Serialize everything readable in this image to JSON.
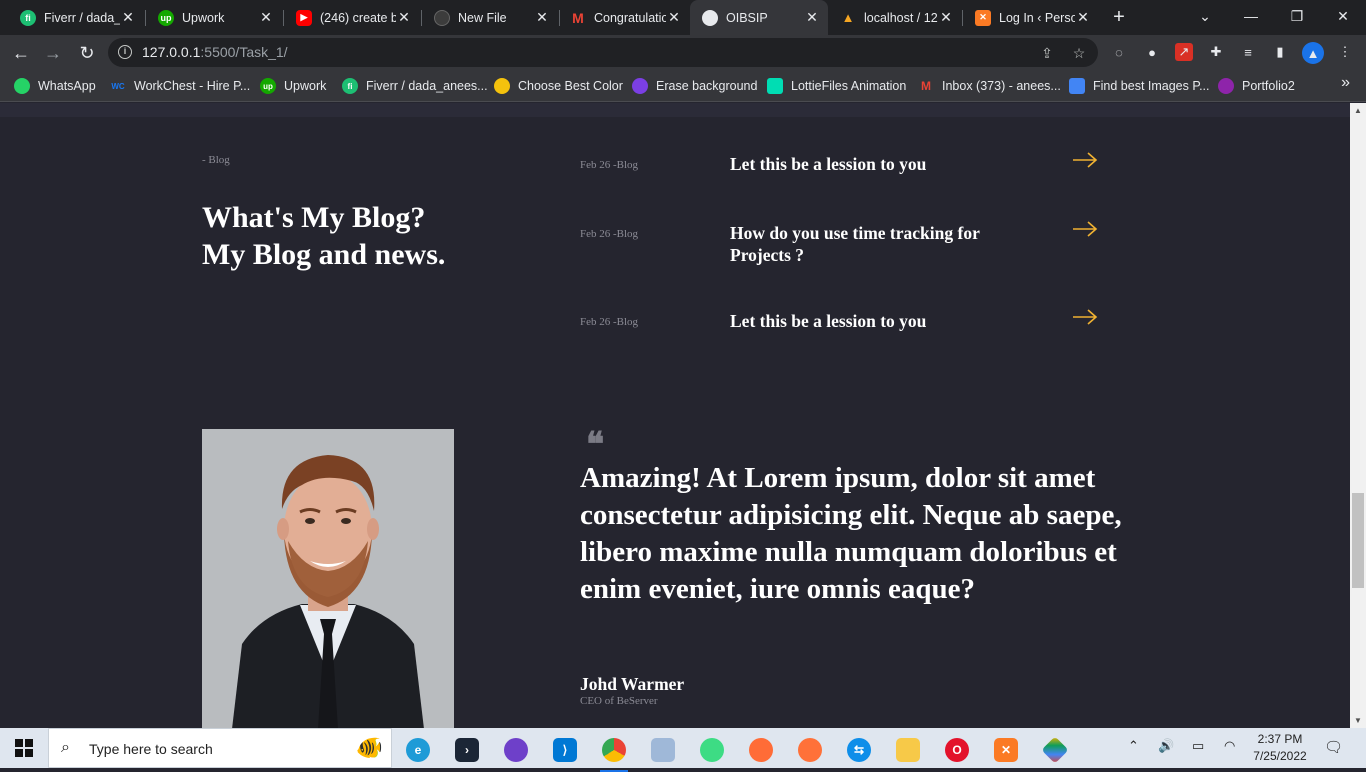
{
  "browser": {
    "tabs": [
      {
        "title": "Fiverr / dada_",
        "icon": "fiverr-icon",
        "color": "#1dbf73",
        "glyph": "fi"
      },
      {
        "title": "Upwork",
        "icon": "upwork-icon",
        "color": "#14a800",
        "glyph": "up"
      },
      {
        "title": "(246) create b",
        "icon": "youtube-icon",
        "color": "#ff0000",
        "glyph": "▶"
      },
      {
        "title": "New File",
        "icon": "github-icon",
        "color": "#444",
        "glyph": ""
      },
      {
        "title": "Congratulatio",
        "icon": "gmail-icon",
        "color": "#ffffff",
        "glyph": "M"
      },
      {
        "title": "OIBSIP",
        "icon": "globe-icon",
        "color": "#e8eaed",
        "glyph": ""
      },
      {
        "title": "localhost / 12",
        "icon": "phpmyadmin-icon",
        "color": "#f5a623",
        "glyph": ""
      },
      {
        "title": "Log In ‹ Perso",
        "icon": "xampp-icon",
        "color": "#fb7a24",
        "glyph": "✕"
      }
    ],
    "url_host": "127.0.0.1",
    "url_rest": ":5500/Task_1/",
    "bookmarks": [
      {
        "label": "WhatsApp",
        "icon": "whatsapp-icon",
        "color": "#25d366"
      },
      {
        "label": "WorkChest - Hire P...",
        "icon": "workchest-icon",
        "color": "#1877f2"
      },
      {
        "label": "Upwork",
        "icon": "upwork-icon",
        "color": "#14a800"
      },
      {
        "label": "Fiverr / dada_anees...",
        "icon": "fiverr-icon",
        "color": "#1dbf73"
      },
      {
        "label": "Choose Best Color",
        "icon": "color-icon",
        "color": "#f4c20d"
      },
      {
        "label": "Erase background",
        "icon": "erase-icon",
        "color": "#7b3fe4"
      },
      {
        "label": "LottieFiles Animation",
        "icon": "lottie-icon",
        "color": "#00ddb3"
      },
      {
        "label": "Inbox (373) - anees...",
        "icon": "gmail-icon",
        "color": "#ea4335"
      },
      {
        "label": "Find best Images P...",
        "icon": "images-icon",
        "color": "#4285f4"
      },
      {
        "label": "Portfolio2",
        "icon": "portfolio-icon",
        "color": "#8e24aa"
      }
    ]
  },
  "blog": {
    "tag": "- Blog",
    "title_line1": "What's My Blog?",
    "title_line2": "My Blog and news.",
    "posts": [
      {
        "date": "Feb 26 -Blog",
        "title": "Let this be a lession to you"
      },
      {
        "date": "Feb 26 -Blog",
        "title": "How do you use time tracking for Projects ?"
      },
      {
        "date": "Feb 26 -Blog",
        "title": "Let this be a lession to you"
      }
    ]
  },
  "testimonial": {
    "mark": "66",
    "quote": "Amazing! At Lorem ipsum, dolor sit amet consectetur adipisicing elit. Neque ab saepe, libero maxime nulla numquam doloribus et enim eveniet, iure omnis eaque?",
    "author": "Johd Warmer",
    "role": "CEO of BeServer"
  },
  "colors": {
    "page_bg": "#25252f",
    "accent_arrow": "#f0b232"
  },
  "taskbar": {
    "search_placeholder": "Type here to search",
    "time": "2:37 PM",
    "date": "7/25/2022"
  }
}
